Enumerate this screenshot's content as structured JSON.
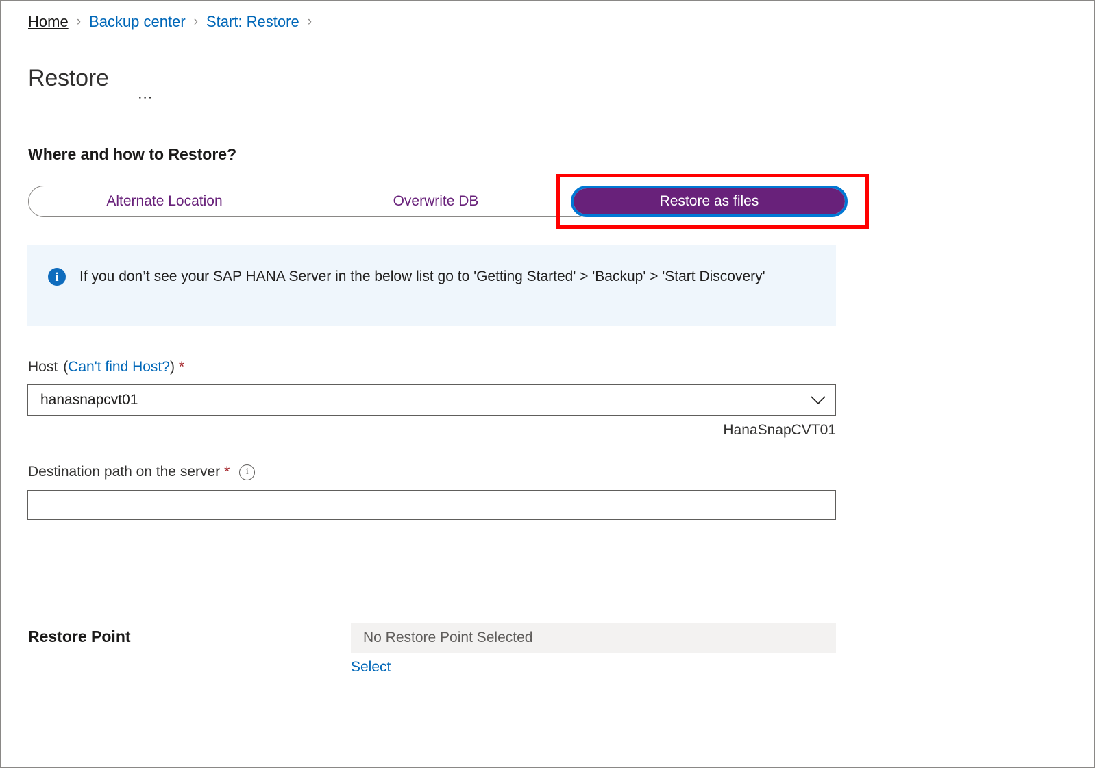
{
  "breadcrumb": {
    "items": [
      {
        "label": "Home",
        "current": false
      },
      {
        "label": "Backup center",
        "current": false
      },
      {
        "label": "Start: Restore",
        "current": false
      }
    ],
    "separator": "›"
  },
  "header": {
    "title": "Restore",
    "more_label": "⋯"
  },
  "section": {
    "heading": "Where and how to Restore?"
  },
  "tabs": {
    "items": [
      {
        "label": "Alternate Location",
        "selected": false
      },
      {
        "label": "Overwrite DB",
        "selected": false
      },
      {
        "label": "Restore as files",
        "selected": true
      }
    ]
  },
  "info_banner": {
    "icon": "info-icon",
    "text": "If you don’t see your SAP HANA Server in the below list go to 'Getting Started' > 'Backup' > 'Start Discovery'"
  },
  "host_field": {
    "label": "Host",
    "link_open": "(",
    "link_text": "Can't find Host?",
    "link_close": ")",
    "required_mark": "*",
    "value": "hanasnapcvt01",
    "helper_text": "HanaSnapCVT01"
  },
  "destination_field": {
    "label": "Destination path on the server",
    "required_mark": "*",
    "info_glyph": "i",
    "value": "",
    "placeholder": ""
  },
  "restore_point": {
    "label": "Restore Point",
    "status_text": "No Restore Point Selected",
    "select_label": "Select"
  },
  "colors": {
    "accent_purple": "#68217A",
    "link_blue": "#0067B8",
    "focus_blue": "#0078D4",
    "required_red": "#A4262C",
    "annotation_red": "#FF0000",
    "info_bg": "#EFF6FC",
    "disabled_bg": "#F3F2F1"
  }
}
